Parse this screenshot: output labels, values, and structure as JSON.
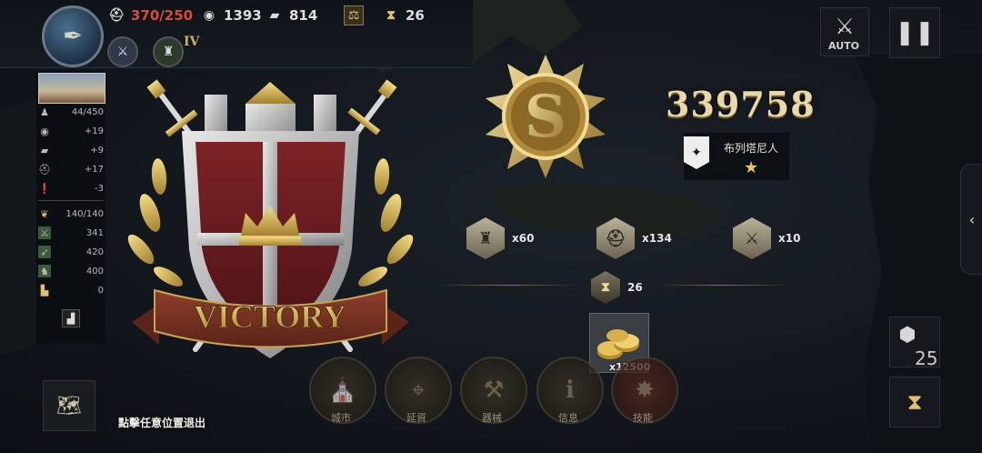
{
  "resources": {
    "manpower": "370/250",
    "silver": "1393",
    "iron": "814",
    "turns": "26"
  },
  "rank_numeral": "IV",
  "city_stats": [
    "44/450",
    "+19",
    "+9",
    "+17",
    "-3",
    "140/140",
    "341",
    "420",
    "400",
    "0"
  ],
  "battle_result": {
    "banner": "VICTORY",
    "score": "339758",
    "faction_name": "布列塔尼人",
    "rewards": [
      {
        "icon": "city-hex-icon",
        "qty": "x60"
      },
      {
        "icon": "helmet-hex-icon",
        "qty": "x134"
      },
      {
        "icon": "swords-hex-icon",
        "qty": "x10"
      }
    ],
    "turn_count": "26",
    "gold_qty": "x12500"
  },
  "bottom_menu": [
    {
      "label": "城市",
      "icon": "cathedral-icon"
    },
    {
      "label": "延資",
      "icon": "map-pin-icon"
    },
    {
      "label": "器械",
      "icon": "catapult-icon"
    },
    {
      "label": "信息",
      "icon": "info-icon"
    },
    {
      "label": "技能",
      "icon": "skill-icon"
    }
  ],
  "exit_hint": "點擊任意位置退出",
  "controls": {
    "auto_label": "AUTO",
    "hex_count": "25"
  },
  "colors": {
    "accent_gold": "#e9d9a8",
    "shield_red": "#6b1d1f",
    "manpower_warning": "#d84a3a"
  }
}
